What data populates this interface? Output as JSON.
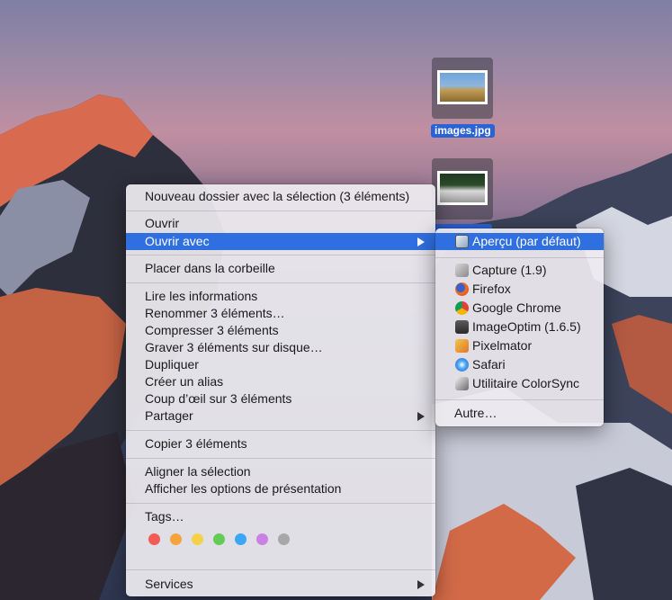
{
  "desktop": {
    "files": [
      {
        "label": "images.jpg"
      },
      {
        "label": ""
      }
    ]
  },
  "context_menu": {
    "items": [
      {
        "label": "Nouveau dossier avec la sélection (3 éléments)"
      },
      {
        "label": "Ouvrir"
      },
      {
        "label": "Ouvrir avec"
      },
      {
        "label": "Placer dans la corbeille"
      },
      {
        "label": "Lire les informations"
      },
      {
        "label": "Renommer 3 éléments…"
      },
      {
        "label": "Compresser 3 éléments"
      },
      {
        "label": "Graver 3 éléments sur disque…"
      },
      {
        "label": "Dupliquer"
      },
      {
        "label": "Créer un alias"
      },
      {
        "label": "Coup d’œil sur 3 éléments"
      },
      {
        "label": "Partager"
      },
      {
        "label": "Copier 3 éléments"
      },
      {
        "label": "Aligner la sélection"
      },
      {
        "label": "Afficher les options de présentation"
      },
      {
        "label": "Tags…"
      },
      {
        "label": "Services"
      }
    ],
    "tag_colors": [
      "#f25b57",
      "#f5a43d",
      "#f4d147",
      "#63cc55",
      "#3aa6f5",
      "#c982e3",
      "#a7a7a7"
    ],
    "highlight_color": "#2f6fe0"
  },
  "open_with_submenu": {
    "items": [
      {
        "label": "Aperçu (par défaut)",
        "icon": "preview-icon"
      },
      {
        "label": "Capture (1.9)",
        "icon": "grab-icon"
      },
      {
        "label": "Firefox",
        "icon": "firefox-icon"
      },
      {
        "label": "Google Chrome",
        "icon": "chrome-icon"
      },
      {
        "label": "ImageOptim (1.6.5)",
        "icon": "imageoptim-icon"
      },
      {
        "label": "Pixelmator",
        "icon": "pixelmator-icon"
      },
      {
        "label": "Safari",
        "icon": "safari-icon"
      },
      {
        "label": "Utilitaire ColorSync",
        "icon": "colorsync-icon"
      },
      {
        "label": "Autre…"
      }
    ]
  }
}
